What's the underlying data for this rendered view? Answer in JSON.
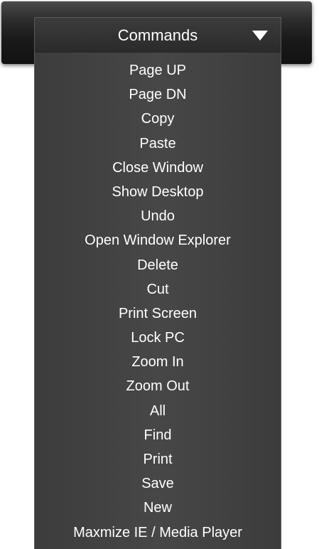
{
  "dropdown": {
    "label": "Commands",
    "icon": "chevron-down-icon"
  },
  "menu": {
    "items": [
      {
        "label": "Page UP",
        "name": "menu-item-page-up"
      },
      {
        "label": "Page DN",
        "name": "menu-item-page-dn"
      },
      {
        "label": "Copy",
        "name": "menu-item-copy"
      },
      {
        "label": "Paste",
        "name": "menu-item-paste"
      },
      {
        "label": "Close Window",
        "name": "menu-item-close-window"
      },
      {
        "label": "Show Desktop",
        "name": "menu-item-show-desktop"
      },
      {
        "label": "Undo",
        "name": "menu-item-undo"
      },
      {
        "label": "Open Window Explorer",
        "name": "menu-item-open-window-explorer"
      },
      {
        "label": "Delete",
        "name": "menu-item-delete"
      },
      {
        "label": "Cut",
        "name": "menu-item-cut"
      },
      {
        "label": "Print Screen",
        "name": "menu-item-print-screen"
      },
      {
        "label": "Lock PC",
        "name": "menu-item-lock-pc"
      },
      {
        "label": "Zoom In",
        "name": "menu-item-zoom-in"
      },
      {
        "label": "Zoom Out",
        "name": "menu-item-zoom-out"
      },
      {
        "label": "All",
        "name": "menu-item-all"
      },
      {
        "label": "Find",
        "name": "menu-item-find"
      },
      {
        "label": "Print",
        "name": "menu-item-print"
      },
      {
        "label": "Save",
        "name": "menu-item-save"
      },
      {
        "label": "New",
        "name": "menu-item-new"
      },
      {
        "label": "Maxmize IE / Media Player",
        "name": "menu-item-maxmize-ie-media-player"
      }
    ]
  },
  "colors": {
    "text": "#ffffff",
    "menu_bg": "#444444",
    "header_bg": "#1a1a1a"
  }
}
